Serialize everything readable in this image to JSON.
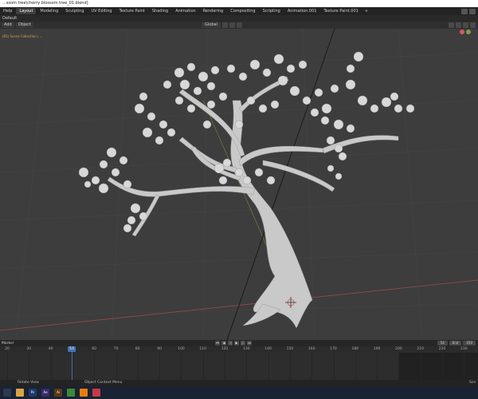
{
  "window": {
    "title": "...ssom tree\\cherry blossom tree_01.blend]"
  },
  "workspaces": {
    "items": [
      "Help",
      "Layout",
      "Modeling",
      "Sculpting",
      "UV Editing",
      "Texture Paint",
      "Shading",
      "Animation",
      "Rendering",
      "Compositing",
      "Scripting",
      "Animation.001",
      "Texture Paint.001"
    ],
    "active_index": 1,
    "add_label": "+"
  },
  "layer": {
    "label": "Default"
  },
  "viewport_header": {
    "mode_label": "Add",
    "object_label": "Object",
    "orientation": "Global"
  },
  "viewport": {
    "collection_label": "(65) Scene Collection | ..."
  },
  "timeline": {
    "header_label": "Marker",
    "current_frame": "54",
    "end_label": "End",
    "end_value": "250",
    "ticks": [
      "20",
      "30",
      "40",
      "50",
      "60",
      "70",
      "80",
      "90",
      "100",
      "110",
      "120",
      "130",
      "140",
      "150",
      "160",
      "170",
      "180",
      "190",
      "200",
      "210",
      "220",
      "230"
    ],
    "playhead_label": "54"
  },
  "statusbar": {
    "left": "Rotate View",
    "center": "Object Context Menu",
    "right": "Sce"
  },
  "taskbar": {
    "apps": [
      {
        "name": "start-icon",
        "color": "#2c3a52",
        "label": ""
      },
      {
        "name": "explorer-icon",
        "color": "#d9a441",
        "label": ""
      },
      {
        "name": "photoshop-icon",
        "color": "#1e3a6e",
        "label": "Ps"
      },
      {
        "name": "aftereffects-icon",
        "color": "#3a2a6e",
        "label": "Ae"
      },
      {
        "name": "illustrator-icon",
        "color": "#5a3a14",
        "label": "Ai"
      },
      {
        "name": "chrome-icon",
        "color": "#3a8a3a",
        "label": ""
      },
      {
        "name": "blender-icon",
        "color": "#e87d0d",
        "label": ""
      },
      {
        "name": "folder-icon",
        "color": "#c53a4a",
        "label": ""
      }
    ]
  }
}
